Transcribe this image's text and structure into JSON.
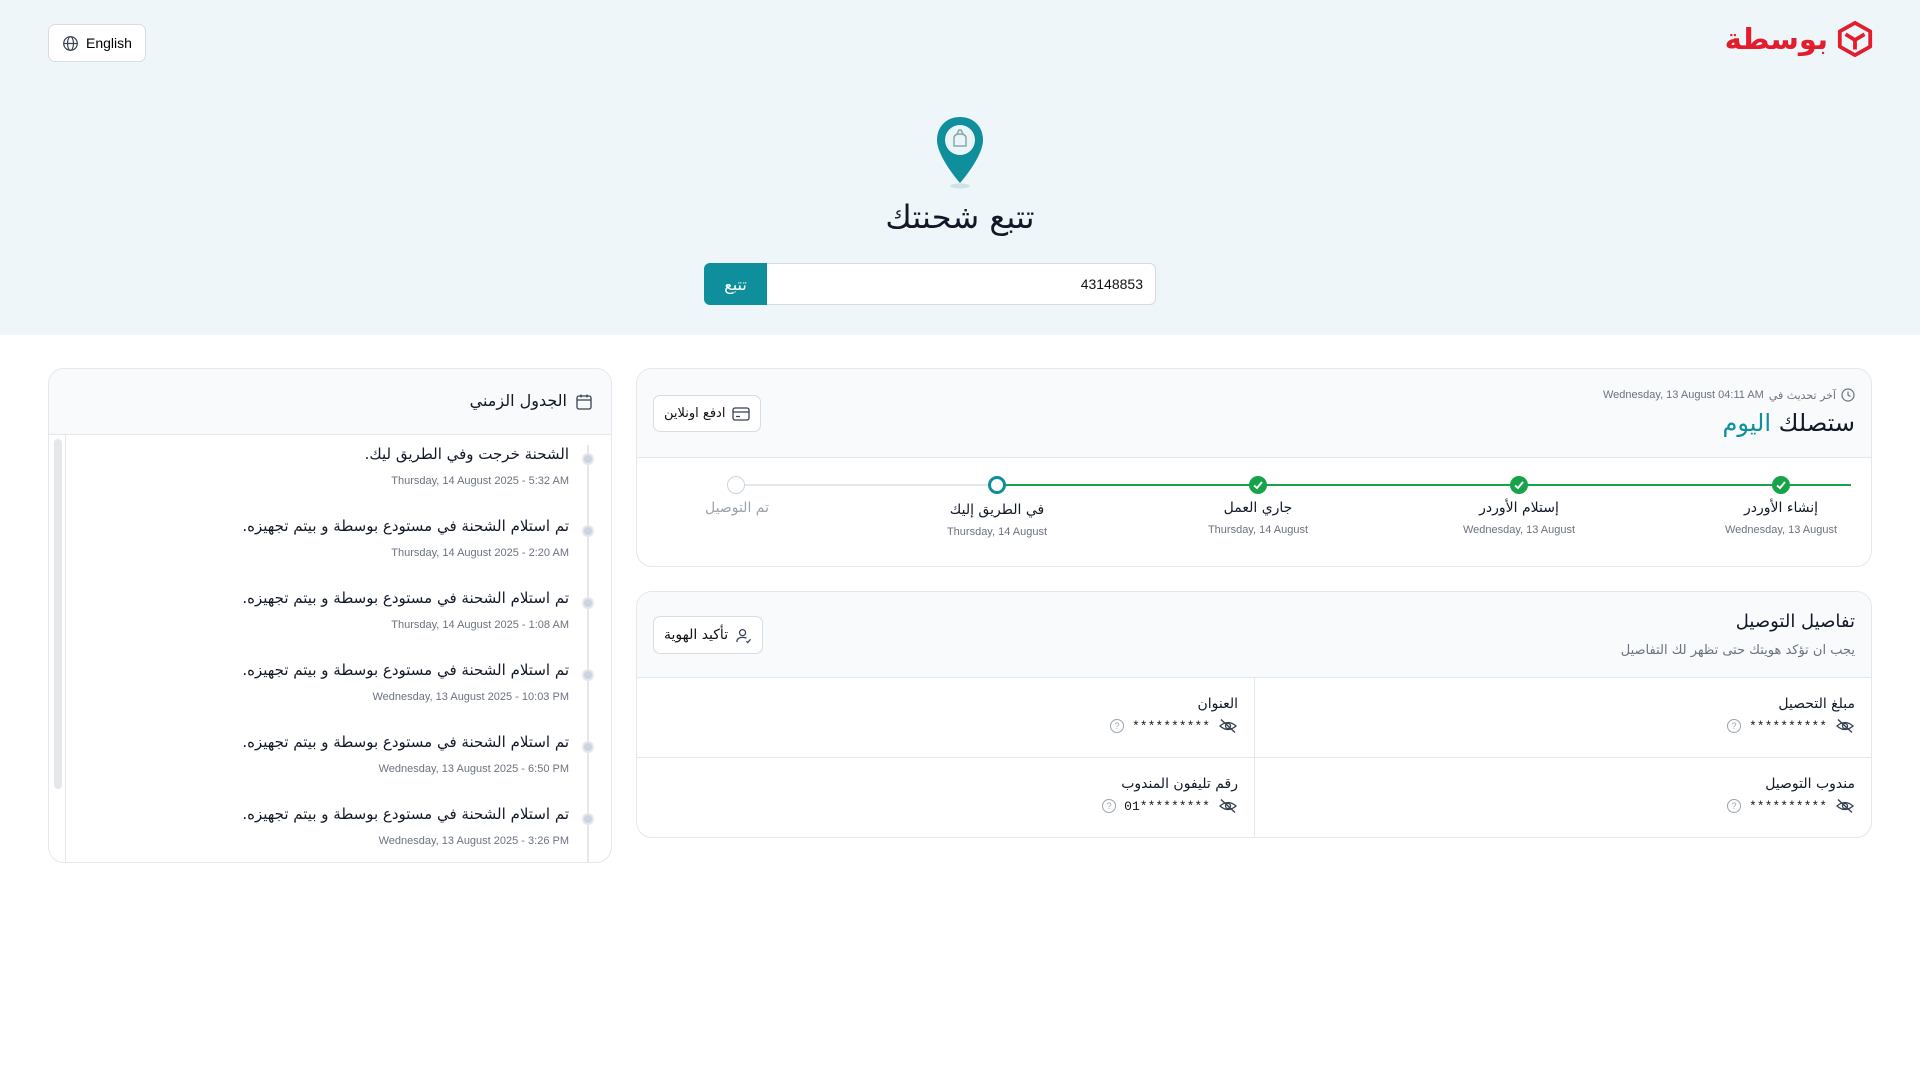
{
  "header": {
    "brand": "بوسطة",
    "language_button": "English"
  },
  "hero": {
    "title": "تتبع شحنتك",
    "tracking_value": "43148853",
    "track_button": "تتبع"
  },
  "timeline": {
    "title": "الجدول الزمني",
    "items": [
      {
        "text": "الشحنة خرجت وفي الطريق ليك.",
        "date": "Thursday, 14 August 2025 - 5:32 AM"
      },
      {
        "text": "تم استلام الشحنة في مستودع بوسطة و بيتم تجهيزه.",
        "date": "Thursday, 14 August 2025 - 2:20 AM"
      },
      {
        "text": "تم استلام الشحنة في مستودع بوسطة و بيتم تجهيزه.",
        "date": "Thursday, 14 August 2025 - 1:08 AM"
      },
      {
        "text": "تم استلام الشحنة في مستودع بوسطة و بيتم تجهيزه.",
        "date": "Wednesday, 13 August 2025 - 10:03 PM"
      },
      {
        "text": "تم استلام الشحنة في مستودع بوسطة و بيتم تجهيزه.",
        "date": "Wednesday, 13 August 2025 - 6:50 PM"
      },
      {
        "text": "تم استلام الشحنة في مستودع بوسطة و بيتم تجهيزه.",
        "date": "Wednesday, 13 August 2025 - 3:26 PM"
      }
    ]
  },
  "status": {
    "updated_label": "آخر تحديث في",
    "updated_value": "Wednesday, 13 August 04:11 AM",
    "title_prefix": "ستصلك",
    "title_accent": "اليوم",
    "pay_button": "ادفع اونلاين",
    "steps": [
      {
        "label": "إنشاء الأوردر",
        "date": "Wednesday, 13 August",
        "state": "done"
      },
      {
        "label": "إستلام الأوردر",
        "date": "Wednesday, 13 August",
        "state": "done"
      },
      {
        "label": "جاري العمل",
        "date": "Thursday, 14 August",
        "state": "done"
      },
      {
        "label": "في الطريق إليك",
        "date": "Thursday, 14 August",
        "state": "current"
      },
      {
        "label": "تم التوصيل",
        "date": "",
        "state": "pending"
      }
    ]
  },
  "details": {
    "title": "تفاصيل التوصيل",
    "subtitle": "يجب ان تؤكد هويتك حتى تظهر لك التفاصيل",
    "verify_button": "تأكيد الهوية",
    "fields": {
      "amount": {
        "label": "مبلغ التحصيل",
        "value": "**********"
      },
      "address": {
        "label": "العنوان",
        "value": "**********"
      },
      "courier": {
        "label": "مندوب التوصيل",
        "value": "**********"
      },
      "courier_phone": {
        "label": "رقم تليفون المندوب",
        "value": "01*********"
      }
    }
  },
  "colors": {
    "brand_red": "#e11d2e",
    "accent_teal": "#0e8f9b",
    "success_green": "#16a34a",
    "hero_bg": "#eef6f9"
  }
}
